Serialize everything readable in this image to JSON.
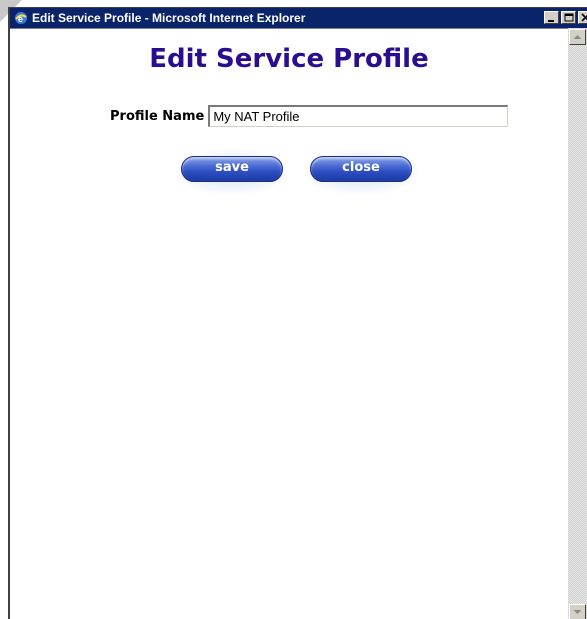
{
  "window": {
    "title": "Edit Service Profile - Microsoft Internet Explorer"
  },
  "page": {
    "heading": "Edit Service Profile",
    "profile_name_label": "Profile Name",
    "profile_name_value": "My NAT Profile"
  },
  "actions": {
    "save_label": "save",
    "close_label": "close"
  },
  "icons": {
    "title_icon": "ie-icon",
    "minimize": "minimize-icon",
    "maximize": "maximize-icon",
    "close": "close-icon",
    "scroll_up": "scroll-up-arrow-icon",
    "scroll_down": "scroll-down-arrow-icon"
  },
  "colors": {
    "titlebar": "#0a246a",
    "heading": "#2a0e8f",
    "button": "#2f4fc0"
  }
}
